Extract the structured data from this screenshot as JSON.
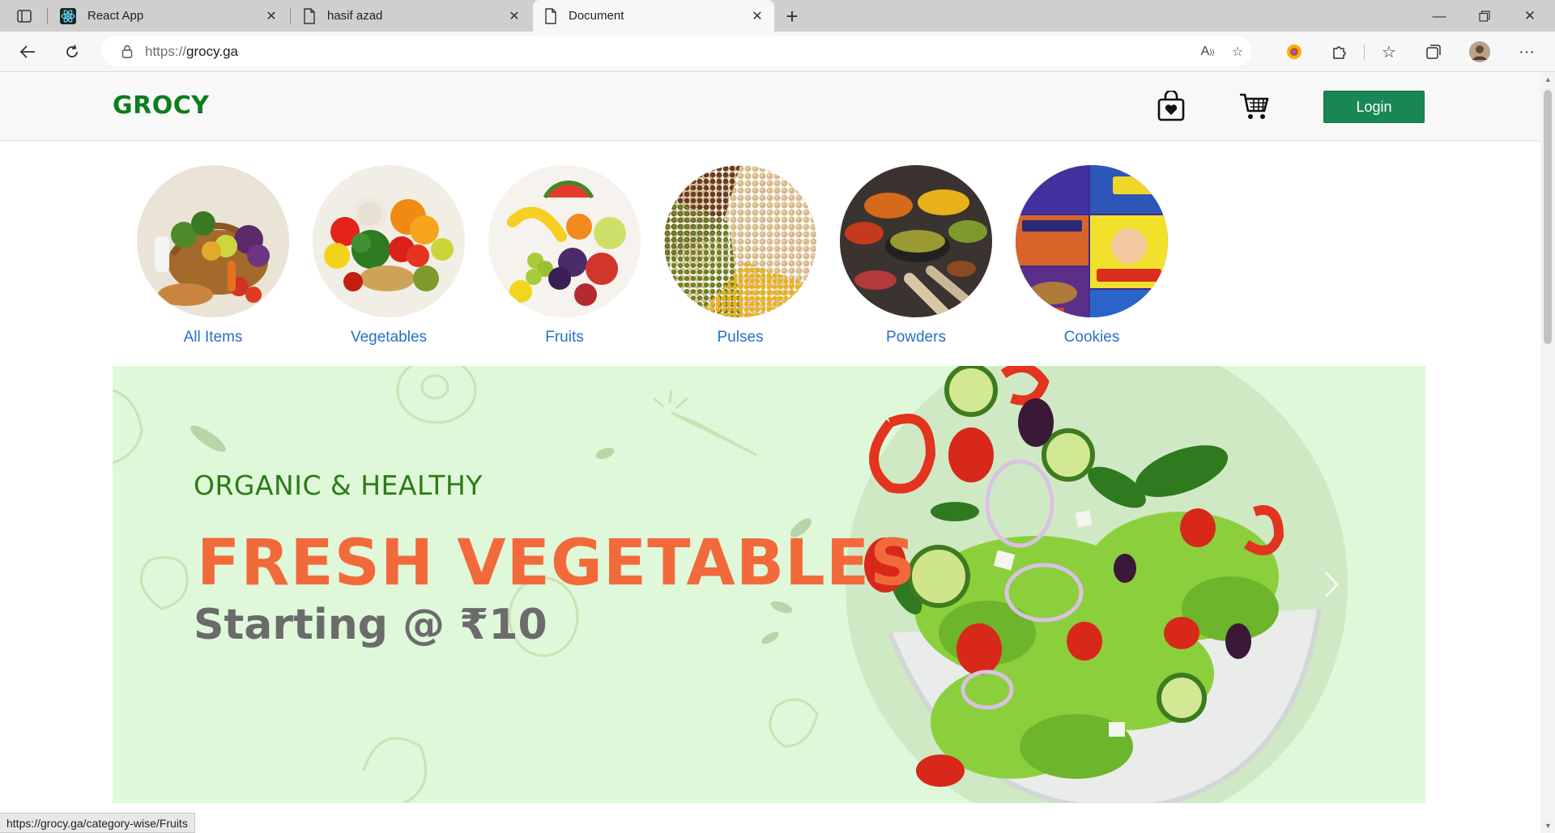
{
  "browser": {
    "tabs": [
      {
        "title": "React App",
        "icon": "react-icon"
      },
      {
        "title": "hasif azad",
        "icon": "document-icon"
      },
      {
        "title": "Document",
        "icon": "document-icon"
      }
    ],
    "url_protocol": "https://",
    "url_host": "grocy.ga",
    "status_url": "https://grocy.ga/category-wise/Fruits"
  },
  "header": {
    "brand": "GROCY",
    "login_label": "Login",
    "icons": [
      "shopping-bag-icon",
      "cart-icon"
    ]
  },
  "categories": [
    {
      "label": "All Items"
    },
    {
      "label": "Vegetables"
    },
    {
      "label": "Fruits"
    },
    {
      "label": "Pulses"
    },
    {
      "label": "Powders"
    },
    {
      "label": "Cookies"
    }
  ],
  "banner": {
    "tagline": "ORGANIC & HEALTHY",
    "headline": "FRESH VEGETABLES",
    "subline": "Starting @ ₹10"
  },
  "colors": {
    "brand": "#0d7d1d",
    "login_button": "#198754",
    "category_link": "#2a6fc9",
    "banner_bg": "#dff8d9",
    "headline": "#f26a3b"
  }
}
